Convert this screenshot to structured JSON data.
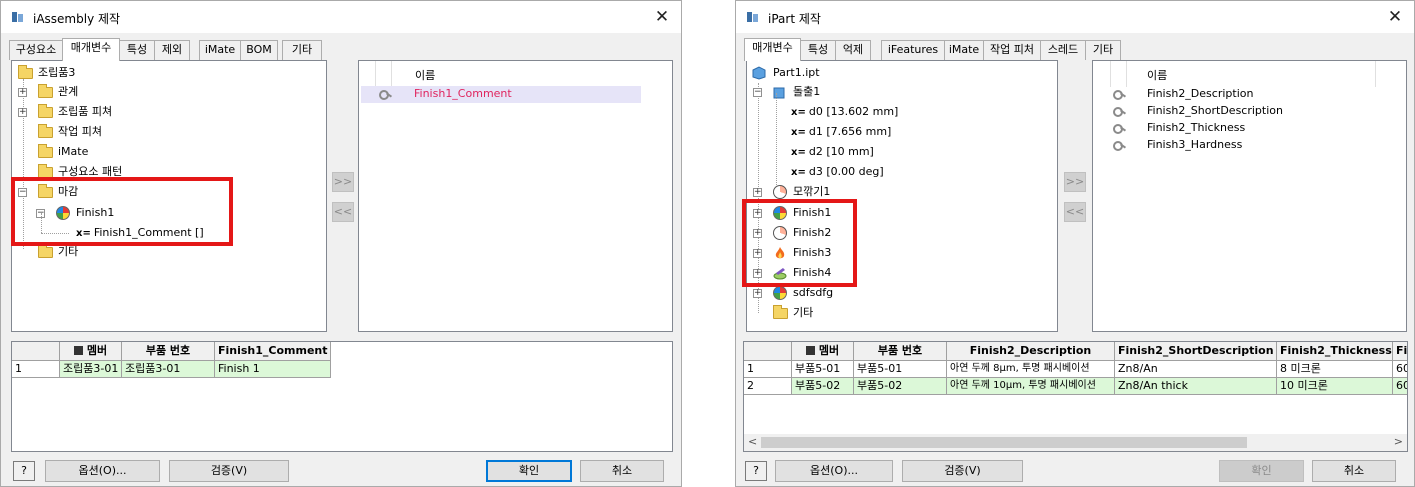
{
  "left": {
    "title": "iAssembly 제작",
    "tabs": [
      "구성요소",
      "매개변수",
      "특성",
      "제외",
      "iMate",
      "BOM",
      "기타"
    ],
    "tree": {
      "root": "조립품3",
      "items": [
        "관계",
        "조립품 피쳐",
        "작업 피쳐",
        "iMate",
        "구성요소 패턴",
        "마감",
        "Finish1",
        "Finish1_Comment []",
        "기타"
      ]
    },
    "list_header": "이름",
    "list_items": [
      "Finish1_Comment"
    ],
    "add_btn": ">>",
    "remove_btn": "<<",
    "table": {
      "columns": [
        "",
        "멤버",
        "부품 번호",
        "Finish1_Comment"
      ],
      "rows": [
        [
          "1",
          "조립품3-01",
          "조립품3-01",
          "Finish 1"
        ]
      ]
    },
    "help": "?",
    "options_btn": "옵션(O)...",
    "verify_btn": "검증(V)",
    "ok_btn": "확인",
    "cancel_btn": "취소"
  },
  "right": {
    "title": "iPart 제작",
    "tabs": [
      "매개변수",
      "특성",
      "억제",
      "iFeatures",
      "iMate",
      "작업 피처",
      "스레드",
      "기타"
    ],
    "tree": {
      "root": "Part1.ipt",
      "items": [
        "돌출1",
        "d0 [13.602 mm]",
        "d1 [7.656 mm]",
        "d2 [10 mm]",
        "d3 [0.00 deg]",
        "모깎기1",
        "Finish1",
        "Finish2",
        "Finish3",
        "Finish4",
        "sdfsdfg",
        "기타"
      ]
    },
    "list_header": "이름",
    "list_items": [
      "Finish2_Description",
      "Finish2_ShortDescription",
      "Finish2_Thickness",
      "Finish3_Hardness"
    ],
    "add_btn": ">>",
    "remove_btn": "<<",
    "table": {
      "columns": [
        "",
        "멤버",
        "부품 번호",
        "Finish2_Description",
        "Finish2_ShortDescription",
        "Finish2_Thickness",
        "Fi"
      ],
      "rows": [
        [
          "1",
          "부품5-01",
          "부품5-01",
          "아연 두께 8µm, 투명 패시베이션",
          "Zn8/An",
          "8 미크론",
          "60"
        ],
        [
          "2",
          "부품5-02",
          "부품5-02",
          "아연 두께 10µm, 투명 패시베이션",
          "Zn8/An thick",
          "10 미크론",
          "60"
        ]
      ]
    },
    "scroll_left": "<",
    "scroll_right": ">",
    "help": "?",
    "options_btn": "옵션(O)...",
    "verify_btn": "검증(V)",
    "ok_btn": "확인",
    "cancel_btn": "취소"
  },
  "colors": {
    "highlight": "#e41717",
    "row_green": "#dcf8d8",
    "selection_purple": "#e6e4f8",
    "default_btn": "#0078d7"
  },
  "close_glyph": "✕"
}
